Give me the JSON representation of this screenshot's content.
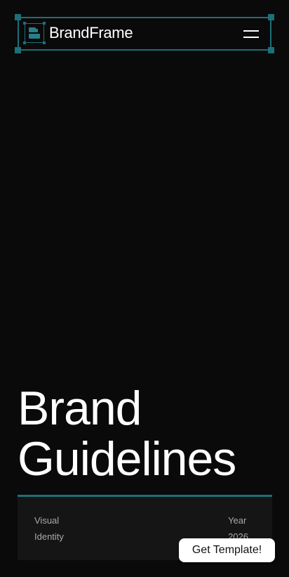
{
  "colors": {
    "background": "#0a0a0a",
    "accent": "#1d6f78",
    "panel": "#151515",
    "text": "#ffffff",
    "muted_text": "#a9a9a9"
  },
  "header": {
    "logo_text": "BrandFrame",
    "logo_icon": "brand-frame-logo-icon",
    "menu_icon": "hamburger-menu-icon"
  },
  "hero": {
    "title_line1": "Brand",
    "title_line2": "Guidelines"
  },
  "info": {
    "left_line1": "Visual",
    "left_line2": "Identity",
    "right_line1": "Year",
    "right_line2": "2026"
  },
  "cta": {
    "label": "Get Template!"
  }
}
